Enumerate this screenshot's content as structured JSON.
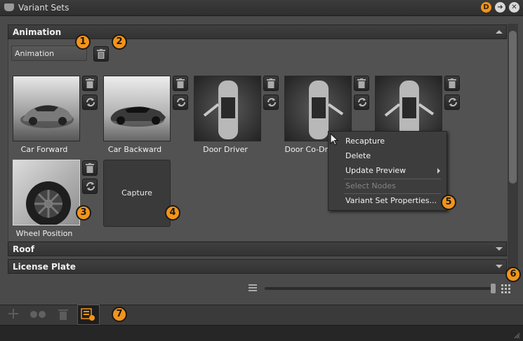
{
  "window": {
    "title": "Variant Sets"
  },
  "title_buttons": [
    {
      "name": "d-badge-icon",
      "label": "D",
      "color": "#f39418"
    },
    {
      "name": "arrow-right-icon",
      "label": "➜",
      "color": "#e0e0e0"
    },
    {
      "name": "close-icon",
      "label": "✕",
      "color": "#e0e0e0"
    }
  ],
  "sections": {
    "animation": "Animation",
    "roof": "Roof",
    "license_plate": "License Plate"
  },
  "variant_name_input": {
    "value": "Animation"
  },
  "variants": [
    {
      "caption": "Car Forward"
    },
    {
      "caption": "Car Backward"
    },
    {
      "caption": "Door Driver"
    },
    {
      "caption": "Door Co-Dr"
    },
    {
      "caption": ""
    },
    {
      "caption": "Wheel Position"
    }
  ],
  "capture_label": "Capture",
  "context_menu": {
    "items": [
      "Recapture",
      "Delete",
      "Update Preview",
      "Select Nodes",
      "Variant Set Properties..."
    ],
    "disabled": [
      "Select Nodes"
    ]
  },
  "badges": [
    "1",
    "2",
    "3",
    "4",
    "5",
    "6",
    "7"
  ],
  "colors": {
    "accent": "#f39418",
    "panel": "#4a4a4a",
    "menu": "#3d3d3d"
  },
  "icons": [
    "trash-icon",
    "refresh-icon",
    "list-view-icon",
    "grid-view-icon",
    "add-icon",
    "link-icon",
    "variant-set-icon",
    "mouse-cursor-icon",
    "resize-grip-icon"
  ]
}
